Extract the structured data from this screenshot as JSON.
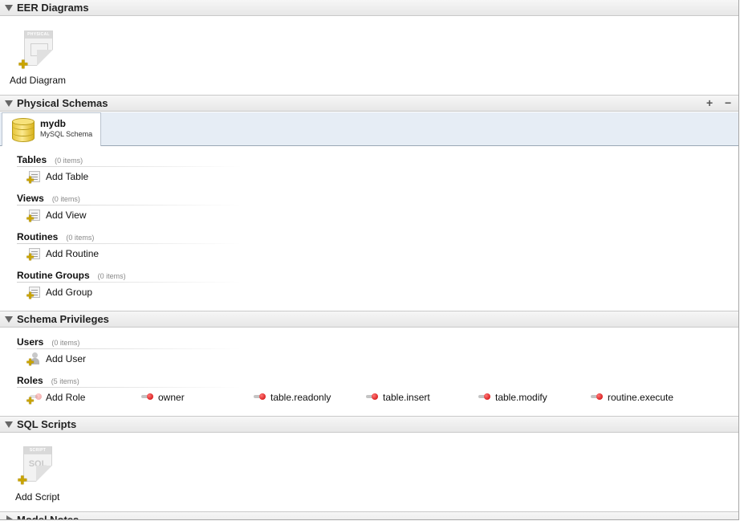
{
  "sections": {
    "eer": {
      "title": "EER Diagrams",
      "add_label": "Add Diagram",
      "icon_band": "PHYSICAL"
    },
    "physical": {
      "title": "Physical Schemas",
      "plus": "+",
      "minus": "−"
    },
    "privileges": {
      "title": "Schema Privileges"
    },
    "scripts": {
      "title": "SQL Scripts",
      "add_label": "Add Script",
      "icon_band": "SCRIPT",
      "icon_text": "SQL"
    },
    "notes": {
      "title": "Model Notes"
    }
  },
  "schema": {
    "name": "mydb",
    "subtitle": "MySQL Schema"
  },
  "groups": {
    "tables": {
      "title": "Tables",
      "count": "(0 items)",
      "add_label": "Add Table"
    },
    "views": {
      "title": "Views",
      "count": "(0 items)",
      "add_label": "Add View"
    },
    "routines": {
      "title": "Routines",
      "count": "(0 items)",
      "add_label": "Add Routine"
    },
    "routine_groups": {
      "title": "Routine Groups",
      "count": "(0 items)",
      "add_label": "Add Group"
    },
    "users": {
      "title": "Users",
      "count": "(0 items)",
      "add_label": "Add User"
    },
    "roles": {
      "title": "Roles",
      "count": "(5 items)",
      "add_label": "Add Role",
      "items": [
        "owner",
        "table.readonly",
        "table.insert",
        "table.modify",
        "routine.execute"
      ]
    }
  },
  "icons": {
    "section_toggle": "disclosure-triangle-icon",
    "add_badge": "plus-badge-icon",
    "schema": "database-icon",
    "role": "role-key-icon",
    "user": "user-icon"
  },
  "colors": {
    "section_bg": "#ececec",
    "schema_strip": "#e6edf5",
    "plus_badge": "#c9a400",
    "role_dot": "#cc0000"
  }
}
